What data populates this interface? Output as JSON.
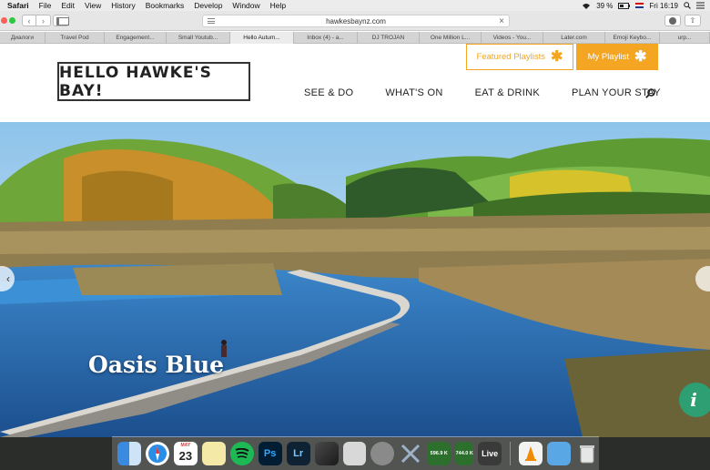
{
  "menubar": {
    "app": "Safari",
    "items": [
      "File",
      "Edit",
      "View",
      "History",
      "Bookmarks",
      "Develop",
      "Window",
      "Help"
    ],
    "battery": "39 %",
    "clock": "Fri 16:19"
  },
  "toolbar": {
    "url": "hawkesbaynz.com"
  },
  "tabs": [
    {
      "label": "Диалоги"
    },
    {
      "label": "Travel Pod"
    },
    {
      "label": "Engagement..."
    },
    {
      "label": "Small Youtub..."
    },
    {
      "label": "Hello Autum..."
    },
    {
      "label": "Inbox (4) - a..."
    },
    {
      "label": "DJ TROJAN"
    },
    {
      "label": "One Million L..."
    },
    {
      "label": "Videos - You..."
    },
    {
      "label": "Later.com"
    },
    {
      "label": "Emoji Keybo..."
    },
    {
      "label": "urp..."
    }
  ],
  "site": {
    "logo": "HELLO HAWKE'S BAY!",
    "featured_playlists": "Featured Playlists",
    "my_playlist": "My Playlist",
    "nav": [
      "SEE & DO",
      "WHAT'S ON",
      "EAT & DRINK",
      "PLAN YOUR STAY"
    ]
  },
  "hero": {
    "title": "Oasis Blue",
    "info_glyph": "i",
    "prev_glyph": "‹"
  },
  "dock": {
    "calendar_month": "MAY",
    "calendar_day": "23",
    "ps": "Ps",
    "lr": "Lr",
    "net_up": "596.9 K",
    "net_down": "744.0 K",
    "live": "Live"
  },
  "colors": {
    "accent": "#f4a623",
    "info_green": "#2e9e73"
  }
}
